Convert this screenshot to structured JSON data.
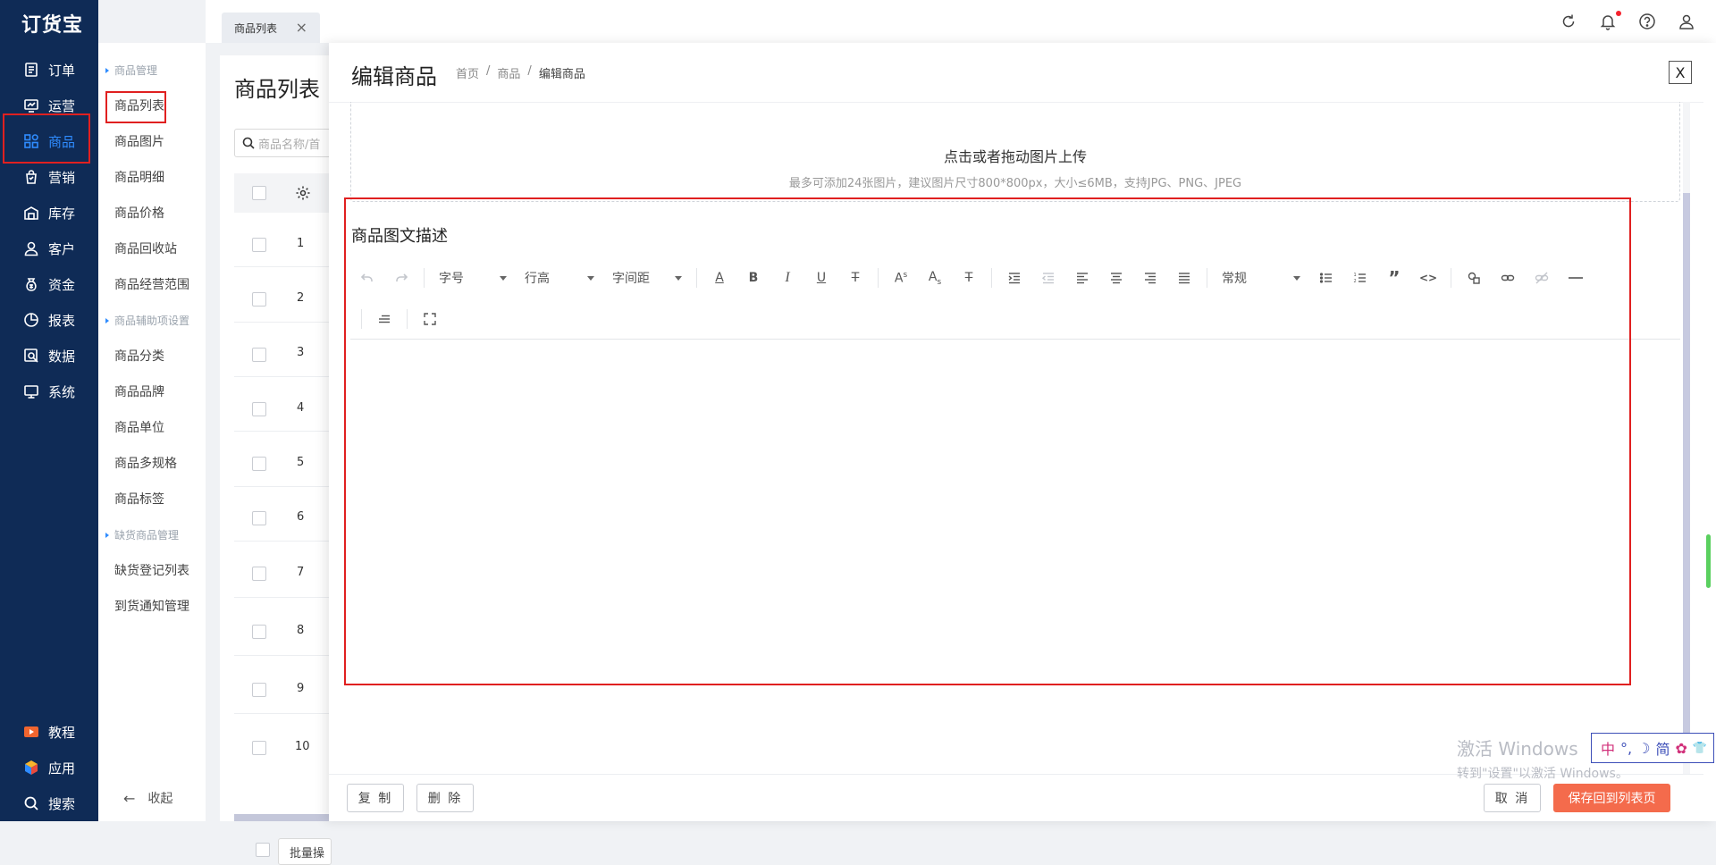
{
  "app": {
    "logo": "订货宝"
  },
  "sidebar": {
    "items": [
      {
        "label": "订单",
        "icon": "order-icon"
      },
      {
        "label": "运营",
        "icon": "chart-board-icon"
      },
      {
        "label": "商品",
        "icon": "grid-apps-icon",
        "active": true
      },
      {
        "label": "营销",
        "icon": "marketing-icon"
      },
      {
        "label": "库存",
        "icon": "stock-icon"
      },
      {
        "label": "客户",
        "icon": "user-icon"
      },
      {
        "label": "资金",
        "icon": "money-bag-icon"
      },
      {
        "label": "报表",
        "icon": "pie-chart-icon"
      },
      {
        "label": "数据",
        "icon": "data-icon"
      },
      {
        "label": "系统",
        "icon": "monitor-icon"
      }
    ],
    "bottom": [
      {
        "label": "教程",
        "icon": "video-icon"
      },
      {
        "label": "应用",
        "icon": "cube-icon"
      },
      {
        "label": "搜索",
        "icon": "search-icon"
      }
    ]
  },
  "submenu": {
    "group1": "商品管理",
    "items1": [
      "商品列表",
      "商品图片",
      "商品明细",
      "商品价格",
      "商品回收站",
      "商品经营范围"
    ],
    "group2": "商品辅助项设置",
    "items2": [
      "商品分类",
      "商品品牌",
      "商品单位",
      "商品多规格",
      "商品标签"
    ],
    "group3": "缺货商品管理",
    "items3": [
      "缺货登记列表",
      "到货通知管理"
    ],
    "collapse": "收起"
  },
  "topbar": {
    "tab_label": "商品列表",
    "tab_close": "×"
  },
  "list": {
    "title": "商品列表",
    "search_placeholder": "商品名称/首",
    "rows": [
      "1",
      "2",
      "3",
      "4",
      "5",
      "6",
      "7",
      "8",
      "9",
      "10"
    ],
    "batch_button": "批量操"
  },
  "drawer": {
    "title": "编辑商品",
    "breadcrumb": [
      "首页",
      "商品",
      "编辑商品"
    ],
    "close": "X",
    "upload": {
      "line1": "点击或者拖动图片上传",
      "line2": "最多可添加24张图片，建议图片尺寸800*800px，大小≤6MB，支持JPG、PNG、JPEG"
    },
    "desc_label": "商品图文描述",
    "toolbar": {
      "font_size": "字号",
      "line_height": "行高",
      "letter_spacing": "字间距",
      "paragraph": "常规"
    },
    "footer": {
      "copy": "复 制",
      "delete": "删 除",
      "cancel": "取 消",
      "save": "保存回到列表页"
    }
  },
  "overlay": {
    "watermark_line1": "激活 Windows",
    "watermark_line2": "转到\"设置\"以激活 Windows。",
    "ime": [
      "中",
      "°,",
      "☽",
      "简",
      "✿",
      "👕"
    ]
  },
  "colors": {
    "sidebar_bg": "#0f2b56",
    "accent": "#2f8cff",
    "primary_button": "#f46b4c",
    "highlight_box": "#e02020"
  }
}
